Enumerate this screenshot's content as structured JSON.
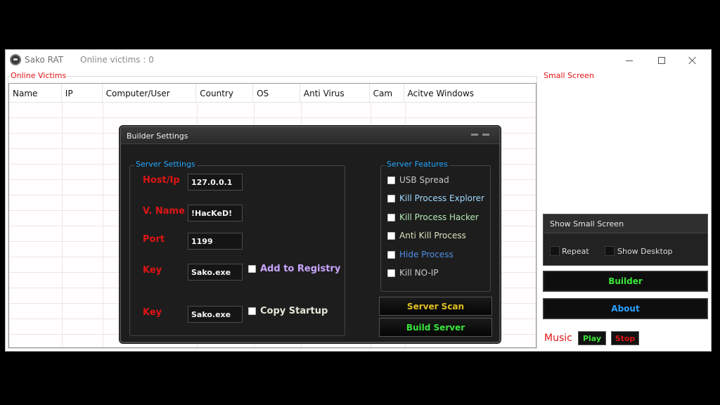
{
  "window": {
    "title": "Sako RAT",
    "online_victims_text": "Online victims : 0"
  },
  "victims": {
    "group_label": "Online Victims",
    "columns": [
      "Name",
      "IP",
      "Computer/User",
      "Country",
      "OS",
      "Anti Virus",
      "Cam",
      "Acitve Windows"
    ]
  },
  "side": {
    "small_screen_label": "Small Screen",
    "show_small_screen_header": "Show Small Screen",
    "repeat_label": "Repeat",
    "show_desktop_label": "Show Desktop",
    "builder_button": "Builder",
    "about_button": "About",
    "music_label": "Music",
    "play_button": "Play",
    "stop_button": "Stop"
  },
  "builder": {
    "title": "Builder Settings",
    "server_settings_label": "Server Settings",
    "host_label": "Host/Ip",
    "host_value": "127.0.0.1",
    "vname_label": "V. Name",
    "vname_value": "!HacKeD!",
    "port_label": "Port",
    "port_value": "1199",
    "key1_label": "Key",
    "key1_value": "Sako.exe",
    "add_registry_label": "Add to Registry",
    "key2_label": "Key",
    "key2_value": "Sako.exe",
    "copy_startup_label": "Copy Startup",
    "server_features_label": "Server Features",
    "features": [
      {
        "label": "USB Spread",
        "color": "#c8c8c8"
      },
      {
        "label": "Kill Process Explorer",
        "color": "#9fd9ff"
      },
      {
        "label": "Kill Process Hacker",
        "color": "#b4e8b4"
      },
      {
        "label": "Anti Kill Process",
        "color": "#e0e0c0"
      },
      {
        "label": "Hide Process",
        "color": "#4f8fe6"
      },
      {
        "label": "Kill NO-IP",
        "color": "#c8c8c8"
      }
    ],
    "server_scan_button": "Server Scan",
    "build_server_button": "Build Server"
  },
  "colors": {
    "accent_red": "#e01414",
    "legend_blue": "#22a7ff",
    "builder_green": "#39e639",
    "about_blue": "#2aa0ff",
    "scan_gold": "#e0c020"
  }
}
